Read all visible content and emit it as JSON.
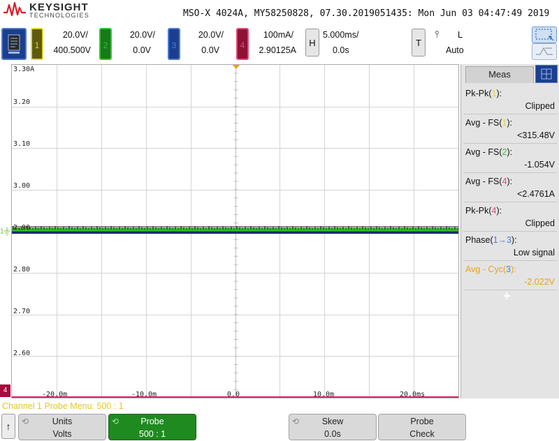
{
  "header": {
    "brand": "KEYSIGHT",
    "brand_sub": "TECHNOLOGIES",
    "title": "MSO-X 4024A, MY58250828, 07.30.2019051435: Mon Jun 03 04:47:49 2019"
  },
  "channels": [
    {
      "num": "1",
      "scale": "20.0V/",
      "offset": "400.500V",
      "color": "#e2d829",
      "bg": "#5f5a11"
    },
    {
      "num": "2",
      "scale": "20.0V/",
      "offset": "0.0V",
      "color": "#35c335",
      "bg": "#187a18"
    },
    {
      "num": "3",
      "scale": "20.0V/",
      "offset": "0.0V",
      "color": "#4d7bd6",
      "bg": "#1b3f8e"
    },
    {
      "num": "4",
      "scale": "100mA/",
      "offset": "2.90125A",
      "color": "#e24a78",
      "bg": "#8f1236"
    }
  ],
  "horizontal": {
    "label": "H",
    "scale": "5.000ms/",
    "delay": "0.0s"
  },
  "trigger": {
    "label": "T",
    "slope": "⫯",
    "level": "L",
    "mode": "Auto"
  },
  "plot": {
    "y_labels": [
      "3.30A",
      "3.20",
      "3.10",
      "3.00",
      "2.90",
      "2.80",
      "2.70",
      "2.60"
    ],
    "x_labels": [
      "-20.0m",
      "-10.0m",
      "0.0",
      "10.0m",
      "20.0ms"
    ],
    "ch4_marker": "4",
    "ch1_marker": "1"
  },
  "meas": {
    "tab": "Meas",
    "items": [
      {
        "name": "Pk-Pk",
        "ch": "1",
        "ch_color": "#e2d829",
        "suffix": "):",
        "value": "Clipped",
        "value_color": "#111111",
        "name_color": "#111111"
      },
      {
        "name": "Avg - FS",
        "ch": "1",
        "ch_color": "#e2d829",
        "suffix": "):",
        "value": "<315.48V",
        "value_color": "#111111",
        "name_color": "#111111"
      },
      {
        "name": "Avg - FS",
        "ch": "2",
        "ch_color": "#35c335",
        "suffix": "):",
        "value": "-1.054V",
        "value_color": "#111111",
        "name_color": "#111111"
      },
      {
        "name": "Avg - FS",
        "ch": "4",
        "ch_color": "#e24a78",
        "suffix": "):",
        "value": "<2.4761A",
        "value_color": "#111111",
        "name_color": "#111111"
      },
      {
        "name": "Pk-Pk",
        "ch": "4",
        "ch_color": "#e24a78",
        "suffix": "):",
        "value": "Clipped",
        "value_color": "#111111",
        "name_color": "#111111"
      },
      {
        "name": "Phase",
        "ch": "1→3",
        "ch_color": "#4d7bd6",
        "suffix": "):",
        "value": "Low signal",
        "value_color": "#111111",
        "name_color": "#111111"
      },
      {
        "name": "Avg - Cyc",
        "ch": "3",
        "ch_color": "#4d7bd6",
        "suffix": "):",
        "value": "-2.022V",
        "value_color": "#e7a21a",
        "name_color": "#e7a21a"
      }
    ],
    "add_symbol": "+"
  },
  "footer": {
    "probe_menu": "Channel 1 Probe Menu: 500 : 1",
    "up_arrow": "↑",
    "softkeys": [
      {
        "line1": "Units",
        "line2": "Volts"
      },
      {
        "line1": "Probe",
        "line2": "500 : 1"
      },
      {
        "line1": "Skew",
        "line2": "0.0s"
      },
      {
        "line1": "Probe",
        "line2": "Check"
      }
    ]
  }
}
